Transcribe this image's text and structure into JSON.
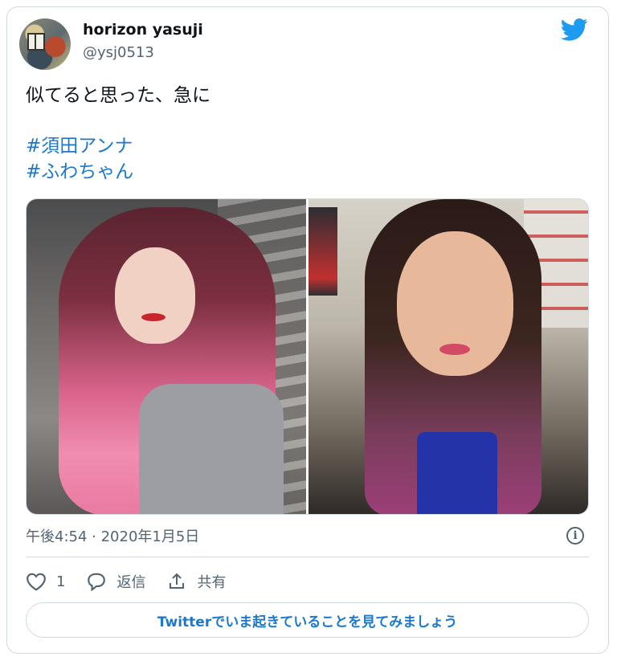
{
  "user": {
    "name": "horizon yasuji",
    "handle": "@ysj0513"
  },
  "icons": {
    "logo": "twitter-bird-icon",
    "info": "info-icon",
    "like": "heart-icon",
    "reply": "reply-bubble-icon",
    "share": "share-icon"
  },
  "tweet": {
    "text": "似てると思った、急に",
    "hashtags": [
      "#須田アンナ",
      "#ふわちゃん"
    ],
    "timestamp": "午後4:54 · 2020年1月5日"
  },
  "actions": {
    "like_count": "1",
    "reply_label": "返信",
    "share_label": "共有"
  },
  "cta_label": "Twitterでいま起きていることを見てみましょう",
  "info_glyph": "i",
  "colors": {
    "brand": "#1d9bf0",
    "link": "#1b78cc",
    "muted": "#536471",
    "border": "#cfd9de"
  }
}
